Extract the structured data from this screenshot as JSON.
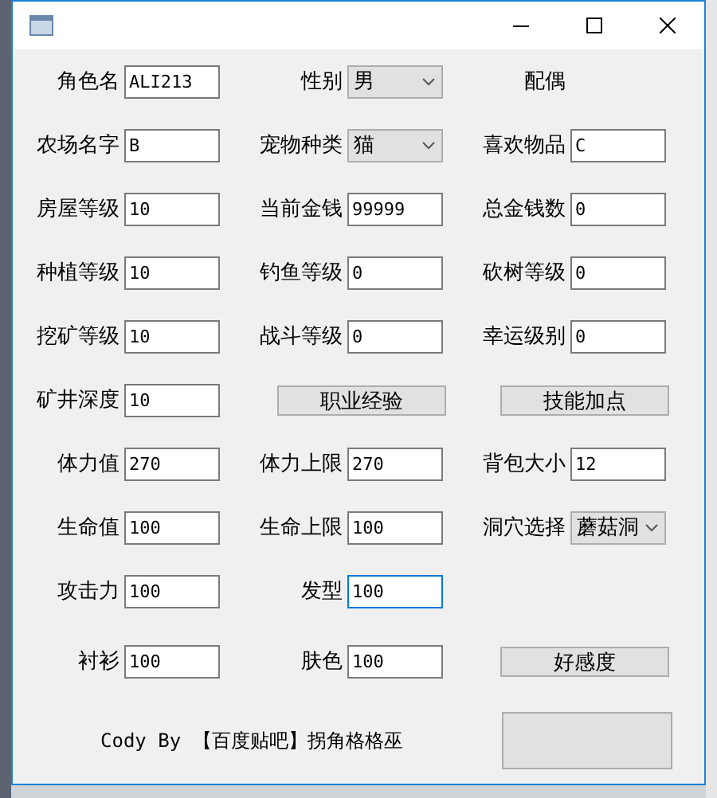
{
  "rows": [
    {
      "cells": [
        {
          "kind": "field",
          "label": "角色名",
          "value": "ALI213",
          "focused": false
        },
        {
          "kind": "select",
          "label": "性别",
          "value": "男"
        },
        {
          "kind": "text",
          "label": "配偶"
        }
      ]
    },
    {
      "cells": [
        {
          "kind": "field",
          "label": "农场名字",
          "value": "B",
          "focused": false
        },
        {
          "kind": "select",
          "label": "宠物种类",
          "value": "猫"
        },
        {
          "kind": "field",
          "label": "喜欢物品",
          "value": "C",
          "focused": false
        }
      ]
    },
    {
      "cells": [
        {
          "kind": "field",
          "label": "房屋等级",
          "value": "10",
          "focused": false
        },
        {
          "kind": "field",
          "label": "当前金钱",
          "value": "99999",
          "focused": false
        },
        {
          "kind": "field",
          "label": "总金钱数",
          "value": "0",
          "focused": false
        }
      ]
    },
    {
      "cells": [
        {
          "kind": "field",
          "label": "种植等级",
          "value": "10",
          "focused": false
        },
        {
          "kind": "field",
          "label": "钓鱼等级",
          "value": "0",
          "focused": false
        },
        {
          "kind": "field",
          "label": "砍树等级",
          "value": "0",
          "focused": false
        }
      ]
    },
    {
      "cells": [
        {
          "kind": "field",
          "label": "挖矿等级",
          "value": "10",
          "focused": false
        },
        {
          "kind": "field",
          "label": "战斗等级",
          "value": "0",
          "focused": false
        },
        {
          "kind": "field",
          "label": "幸运级别",
          "value": "0",
          "focused": false
        }
      ]
    },
    {
      "cells": [
        {
          "kind": "field",
          "label": "矿井深度",
          "value": "10",
          "focused": false
        },
        {
          "kind": "button",
          "label": "职业经验"
        },
        {
          "kind": "button",
          "label": "技能加点"
        }
      ]
    },
    {
      "cells": [
        {
          "kind": "field",
          "label": "体力值",
          "value": "270",
          "focused": false
        },
        {
          "kind": "field",
          "label": "体力上限",
          "value": "270",
          "focused": false
        },
        {
          "kind": "field",
          "label": "背包大小",
          "value": "12",
          "focused": false
        }
      ]
    },
    {
      "cells": [
        {
          "kind": "field",
          "label": "生命值",
          "value": "100",
          "focused": false
        },
        {
          "kind": "field",
          "label": "生命上限",
          "value": "100",
          "focused": false
        },
        {
          "kind": "select",
          "label": "洞穴选择",
          "value": "蘑菇洞"
        }
      ]
    },
    {
      "cells": [
        {
          "kind": "field",
          "label": "攻击力",
          "value": "100",
          "focused": false
        },
        {
          "kind": "field",
          "label": "发型",
          "value": "100",
          "focused": true
        },
        {
          "kind": "empty"
        }
      ]
    },
    {
      "cells": [
        {
          "kind": "field",
          "label": "衬衫",
          "value": "100",
          "focused": false
        },
        {
          "kind": "field",
          "label": "肤色",
          "value": "100",
          "focused": false
        },
        {
          "kind": "button",
          "label": "好感度"
        }
      ]
    }
  ],
  "footer": {
    "credit": "Cody By 【百度贴吧】拐角格格巫"
  }
}
